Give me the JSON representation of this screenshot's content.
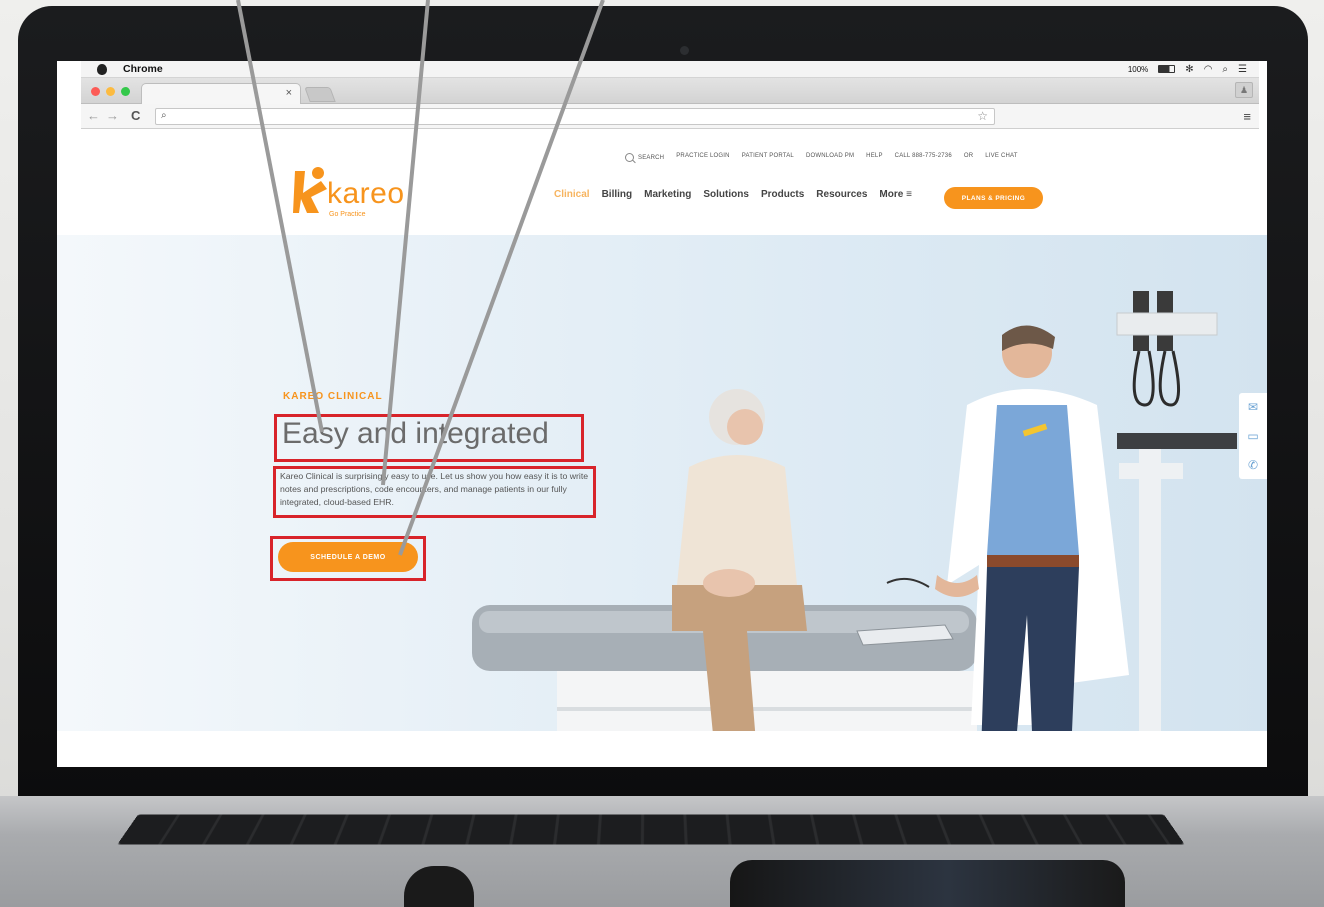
{
  "os_menubar": {
    "app": "Chrome",
    "battery": "100%",
    "icons": [
      "apple-icon",
      "battery-icon",
      "bluetooth-icon",
      "wifi-icon",
      "spotlight-icon",
      "notification-list-icon"
    ]
  },
  "browser": {
    "tab_close": "×",
    "back": "←",
    "forward": "→",
    "reload": "C",
    "omnibox_search_icon": "⌕",
    "star": "☆",
    "menu": "≡",
    "profile": "♟"
  },
  "site": {
    "logo_word": "kareo",
    "logo_tagline": "Go Practice",
    "utility_nav": [
      "SEARCH",
      "PRACTICE LOGIN",
      "PATIENT PORTAL",
      "DOWNLOAD PM",
      "HELP",
      "CALL 888-775-2736",
      "OR",
      "LIVE CHAT"
    ],
    "main_nav": [
      "Clinical",
      "Billing",
      "Marketing",
      "Solutions",
      "Products",
      "Resources",
      "More ≡"
    ],
    "plans_button": "PLANS & PRICING"
  },
  "hero": {
    "eyebrow": "KAREO CLINICAL",
    "headline": "Easy and integrated",
    "body": "Kareo Clinical is surprisingly easy to use. Let us show you how easy it is to write notes and prescriptions, code encounters, and manage patients in our fully integrated, cloud-based EHR.",
    "cta": "SCHEDULE A DEMO"
  },
  "side_contact": [
    "✉",
    "▭",
    "✆"
  ],
  "colors": {
    "brand_orange": "#f7941d",
    "annotation_red": "#d8232a",
    "hero_blue": "#dbe9f3"
  }
}
